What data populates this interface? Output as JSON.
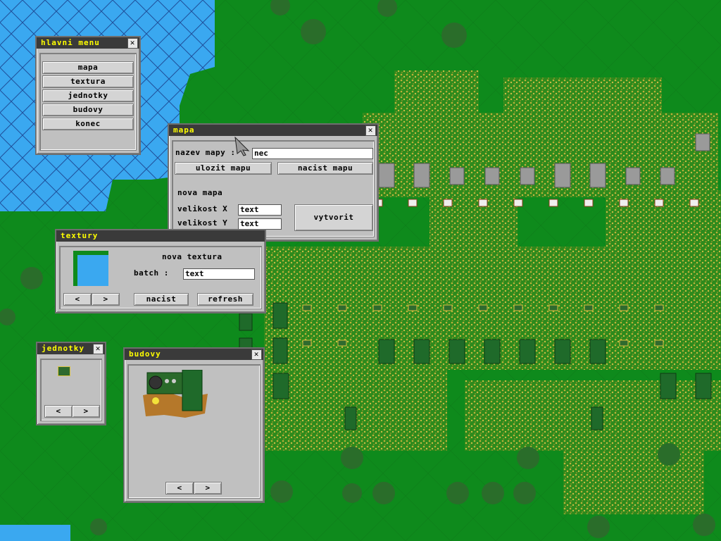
{
  "colors": {
    "grass": "#0f8a1c",
    "grass_light": "#1ba12a",
    "dry_grass": "#b0a23a",
    "water": "#3aa8f0",
    "title_bar": "#3a3a3a",
    "title_text": "#ffff00",
    "window_bg": "#c0c0c0"
  },
  "main_menu": {
    "title": "hlavni menu",
    "items": [
      "mapa",
      "textura",
      "jednotky",
      "budovy",
      "konec"
    ]
  },
  "map_window": {
    "title": "mapa",
    "name_label": "nazev mapy :",
    "name_value": "nec",
    "save_button": "ulozit mapu",
    "load_button": "nacist mapu",
    "new_map_label": "nova mapa",
    "size_x_label": "velikost X",
    "size_x_value": "text",
    "size_y_label": "velikost Y",
    "size_y_value": "text",
    "create_button": "vytvorit"
  },
  "textures_window": {
    "title": "textury",
    "new_texture_label": "nova textura",
    "batch_label": "batch :",
    "batch_value": "text",
    "prev_button": "<",
    "next_button": ">",
    "load_button": "nacist",
    "refresh_button": "refresh"
  },
  "units_window": {
    "title": "jednotky",
    "prev_button": "<",
    "next_button": ">"
  },
  "buildings_window": {
    "title": "budovy",
    "prev_button": "<",
    "next_button": ">"
  },
  "icons": {
    "close": "close-icon",
    "cursor": "arrow-cursor-icon"
  }
}
